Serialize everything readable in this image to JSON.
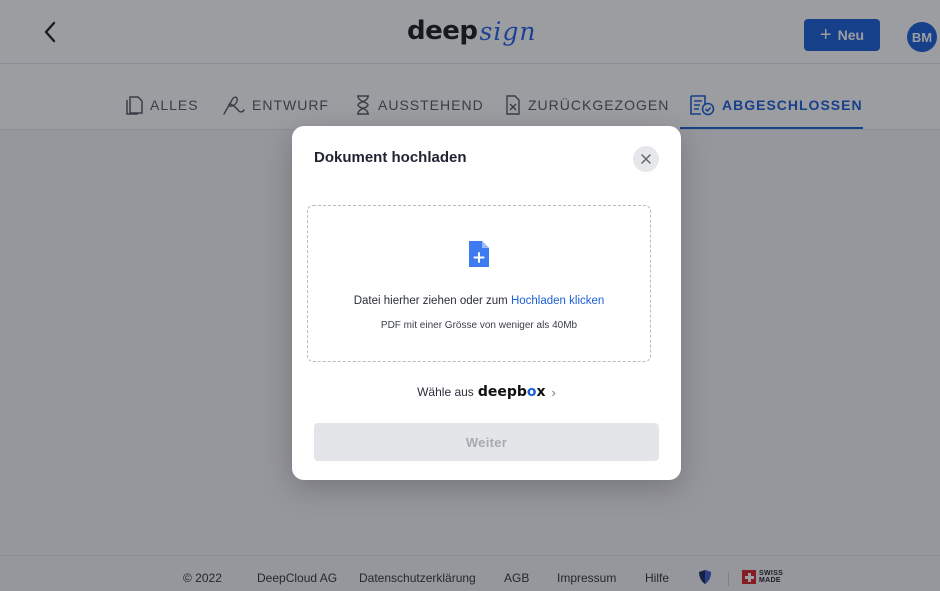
{
  "header": {
    "logo_main": "deep",
    "logo_script": "sign",
    "new_button_label": "Neu",
    "avatar_initials": "BM"
  },
  "tabs": [
    {
      "label": "ALLES",
      "active": false,
      "icon": "document-icon"
    },
    {
      "label": "ENTWURF",
      "active": false,
      "icon": "signature-icon"
    },
    {
      "label": "AUSSTEHEND",
      "active": false,
      "icon": "hourglass-icon"
    },
    {
      "label": "ZURÜCKGEZOGEN",
      "active": false,
      "icon": "document-x-icon"
    },
    {
      "label": "ABGESCHLOSSEN",
      "active": true,
      "icon": "document-check-icon"
    }
  ],
  "modal": {
    "title": "Dokument hochladen",
    "drop_text": "Datei hierher ziehen oder zum ",
    "drop_link": "Hochladen klicken",
    "drop_hint": "PDF mit einer Grösse von weniger als 40Mb",
    "choose_prefix": "Wähle aus",
    "deepbox_main": "deepb",
    "deepbox_o": "o",
    "deepbox_end": "x",
    "continue_label": "Weiter"
  },
  "footer": {
    "copyright": "© 2022",
    "company": "DeepCloud AG",
    "links": [
      "Datenschutzerklärung",
      "AGB",
      "Impressum",
      "Hilfe"
    ],
    "badge_line1": "SWISS",
    "badge_line2": "MADE"
  },
  "colors": {
    "accent": "#1b5fd8",
    "swiss_red": "#d9232a",
    "disabled_button": "#e4e5e8"
  }
}
